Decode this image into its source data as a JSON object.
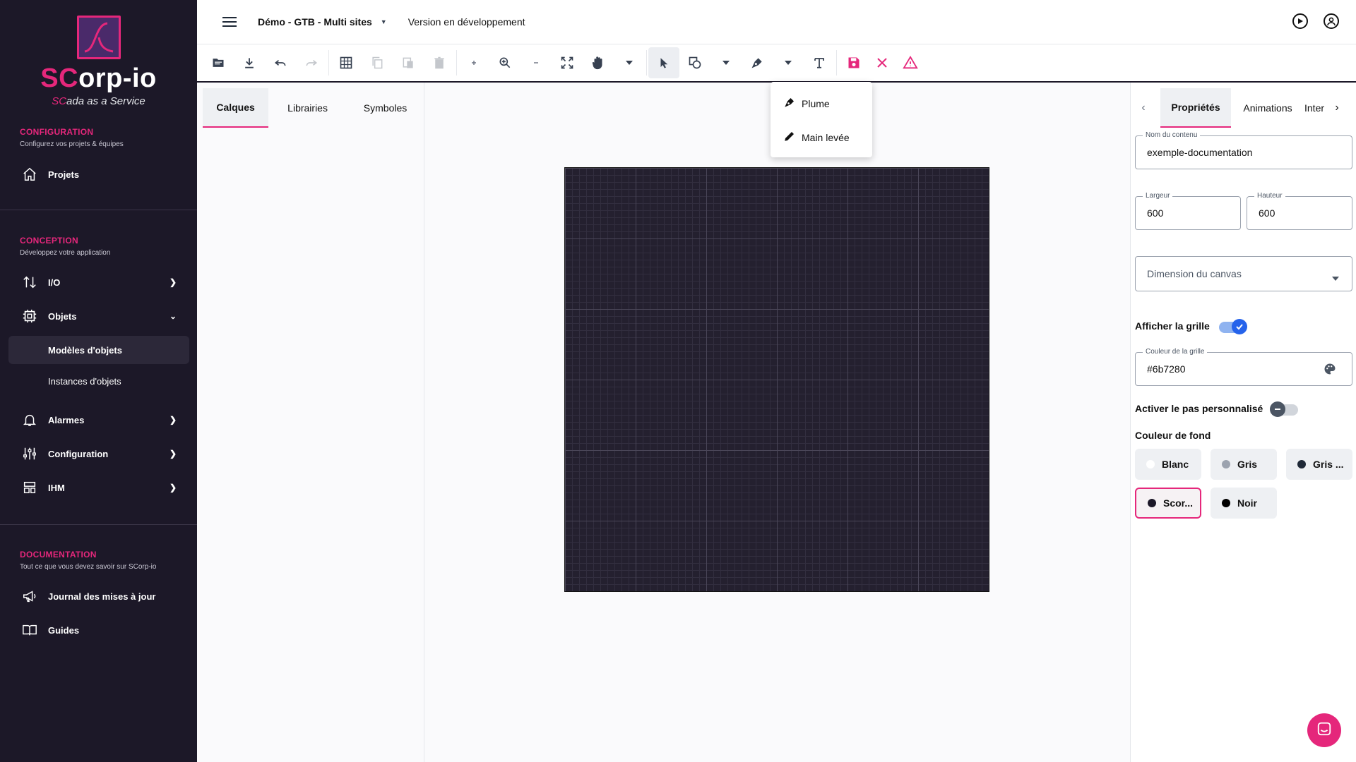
{
  "sidebar": {
    "logo": {
      "prefix": "SC",
      "rest": "orp-io",
      "sub_prefix": "SC",
      "sub_rest": "ada as a Service"
    },
    "sections": [
      {
        "title": "CONFIGURATION",
        "subtitle": "Configurez vos projets & équipes"
      },
      {
        "title": "CONCEPTION",
        "subtitle": "Développez votre application"
      },
      {
        "title": "DOCUMENTATION",
        "subtitle": "Tout ce que vous devez savoir sur SCorp-io"
      }
    ],
    "items": {
      "projets": "Projets",
      "io": "I/O",
      "objets": "Objets",
      "modeles": "Modèles d'objets",
      "instances": "Instances d'objets",
      "alarmes": "Alarmes",
      "configuration": "Configuration",
      "ihm": "IHM",
      "journal": "Journal des mises à jour",
      "guides": "Guides"
    }
  },
  "topbar": {
    "project": "Démo - GTB - Multi sites",
    "version": "Version en développement"
  },
  "left_tabs": {
    "calques": "Calques",
    "librairies": "Librairies",
    "symboles": "Symboles"
  },
  "dropdown": {
    "plume": "Plume",
    "main_levee": "Main levée"
  },
  "right_tabs": {
    "proprietes": "Propriétés",
    "animations": "Animations",
    "interactions": "Interactions"
  },
  "properties": {
    "content_name_label": "Nom du contenu",
    "content_name": "exemple-documentation",
    "width_label": "Largeur",
    "width": "600",
    "height_label": "Hauteur",
    "height": "600",
    "canvas_dim_placeholder": "Dimension du canvas",
    "show_grid_label": "Afficher la grille",
    "show_grid": true,
    "grid_color_label": "Couleur de la grille",
    "grid_color": "#6b7280",
    "custom_step_label": "Activer le pas personnalisé",
    "custom_step": false,
    "bg_color_label": "Couleur de fond",
    "bg_options": [
      {
        "label": "Blanc",
        "color": "#ffffff"
      },
      {
        "label": "Gris",
        "color": "#9ca3af"
      },
      {
        "label": "Gris ...",
        "color": "#1f2937"
      },
      {
        "label": "Scor...",
        "color": "#1c1828",
        "selected": true
      },
      {
        "label": "Noir",
        "color": "#000000"
      }
    ]
  },
  "colors": {
    "accent": "#e5277b",
    "sidebar_bg": "#1c1828",
    "canvas_bg": "#24202f"
  }
}
